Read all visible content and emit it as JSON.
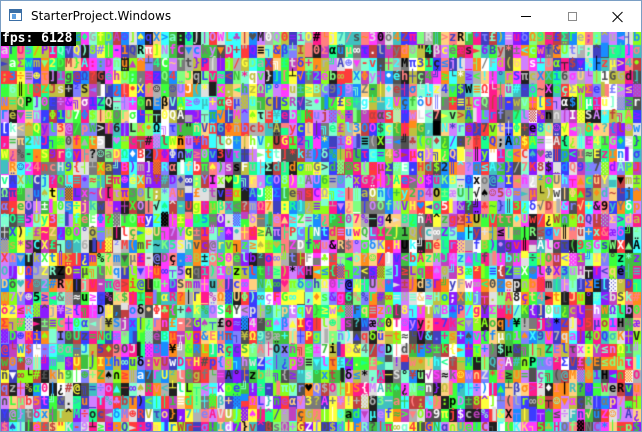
{
  "window": {
    "title": "StarterProject.Windows",
    "icon": "app-window-icon",
    "controls": {
      "minimize": "minimize-icon",
      "maximize": "maximize-icon",
      "close": "close-icon"
    }
  },
  "overlay": {
    "fps_text": "fps: 6128"
  }
}
